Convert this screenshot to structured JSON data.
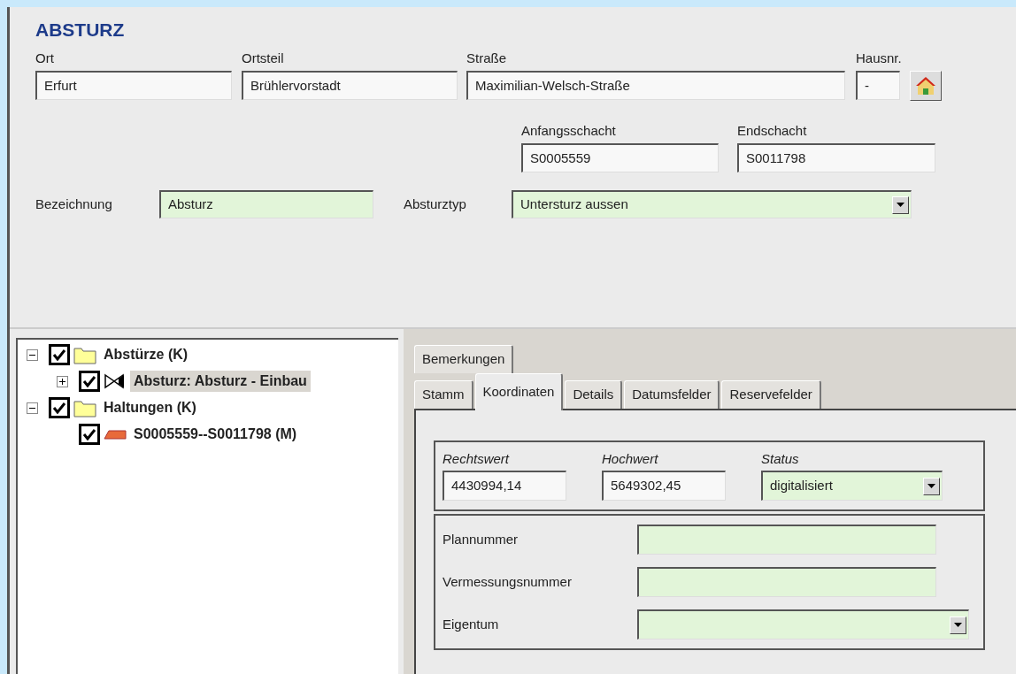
{
  "header": {
    "title": "ABSTURZ"
  },
  "address": [
    {
      "label": "Ort",
      "value": "Erfurt",
      "required": false
    },
    {
      "label": "Ortsteil",
      "value": "Brühlervorstadt",
      "required": false
    },
    {
      "label": "Straße",
      "value": "Maximilian-Welsch-Straße",
      "required": false
    },
    {
      "label": "Hausnr.",
      "value": "-",
      "required": false
    }
  ],
  "shafts": [
    {
      "label": "Anfangsschacht",
      "value": "S0005559",
      "required": false
    },
    {
      "label": "Endschacht",
      "value": "S0011798",
      "required": false
    }
  ],
  "bezeichnung": {
    "label": "Bezeichnung",
    "value": "Absturz",
    "required": true
  },
  "absturztyp": {
    "label": "Absturztyp",
    "value": "Untersturz aussen",
    "required": true
  },
  "tree": [
    {
      "label": "Abstürze (K)",
      "kind": "folder",
      "checked": true,
      "expanded": true,
      "selected": false,
      "children": [
        {
          "label": "Absturz: Absturz - Einbau",
          "kind": "valve",
          "checked": true,
          "expanded": false,
          "selected": true
        }
      ]
    },
    {
      "label": "Haltungen (K)",
      "kind": "folder",
      "checked": true,
      "expanded": true,
      "selected": false,
      "children": [
        {
          "label": "S0005559--S0011798 (M)",
          "kind": "pipe",
          "checked": true,
          "selected": false
        }
      ]
    }
  ],
  "tab_rows": [
    [
      {
        "label": "Bemerkungen",
        "selected": false
      }
    ],
    [
      {
        "label": "Stamm",
        "selected": false
      },
      {
        "label": "Koordinaten",
        "selected": true
      },
      {
        "label": "Details",
        "selected": false
      },
      {
        "label": "Datumsfelder",
        "selected": false
      },
      {
        "label": "Reservefelder",
        "selected": false
      }
    ]
  ],
  "coordinates": [
    {
      "label": "Rechtswert",
      "value": "4430994,14",
      "kind": "text",
      "required": false
    },
    {
      "label": "Hochwert",
      "value": "5649302,45",
      "kind": "text",
      "required": false
    },
    {
      "label": "Status",
      "value": "digitalisiert",
      "kind": "combo",
      "required": true
    }
  ],
  "details": [
    {
      "label": "Plannummer",
      "kind": "text",
      "required": true
    },
    {
      "label": "Vermessungsnummer",
      "kind": "text",
      "required": true
    },
    {
      "label": "Eigentum",
      "kind": "combo",
      "required": true
    }
  ]
}
